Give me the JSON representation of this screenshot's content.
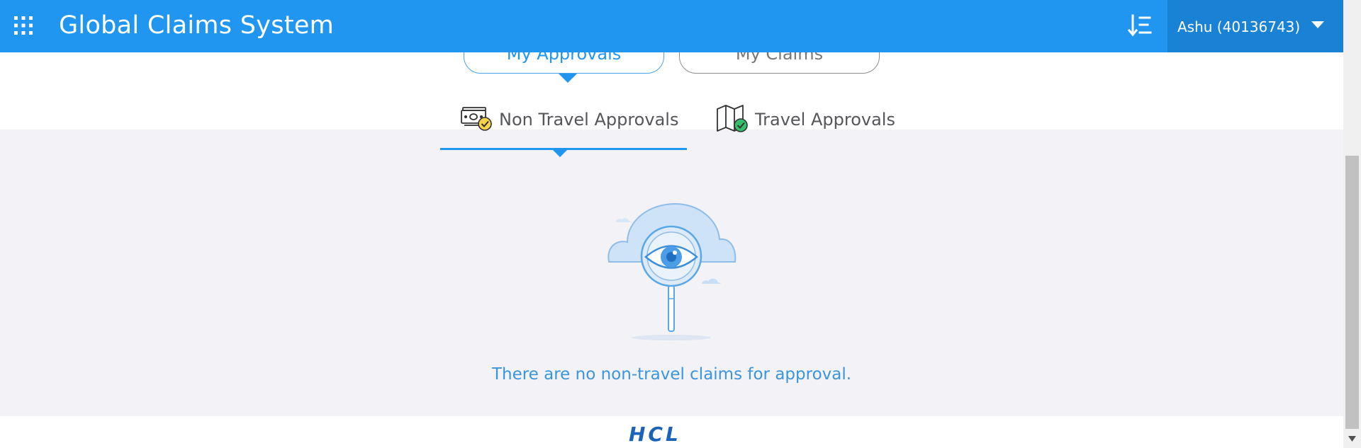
{
  "header": {
    "app_title": "Global Claims System",
    "apps_icon": "grid-icon",
    "sort_icon": "sort-icon",
    "user_label": "Ashu (40136743)",
    "user_caret_icon": "caret-down-icon",
    "background_color": "#2196f0",
    "user_menu_color": "#1a82d4"
  },
  "top_tabs": [
    {
      "label": "My Approvals",
      "active": true
    },
    {
      "label": "My Claims",
      "active": false
    }
  ],
  "sub_tabs": [
    {
      "label": "Non Travel Approvals",
      "icon": "money-check-icon",
      "active": true
    },
    {
      "label": "Travel Approvals",
      "icon": "map-check-icon",
      "active": false
    }
  ],
  "empty_state": {
    "illustration": "cloud-magnifier-eye-icon",
    "message": "There are no non-travel claims for approval."
  },
  "footer": {
    "logo_text": "HCL"
  },
  "colors": {
    "accent": "#2196f0",
    "content_background": "#f3f3f7",
    "message_text": "#3b95dc"
  }
}
